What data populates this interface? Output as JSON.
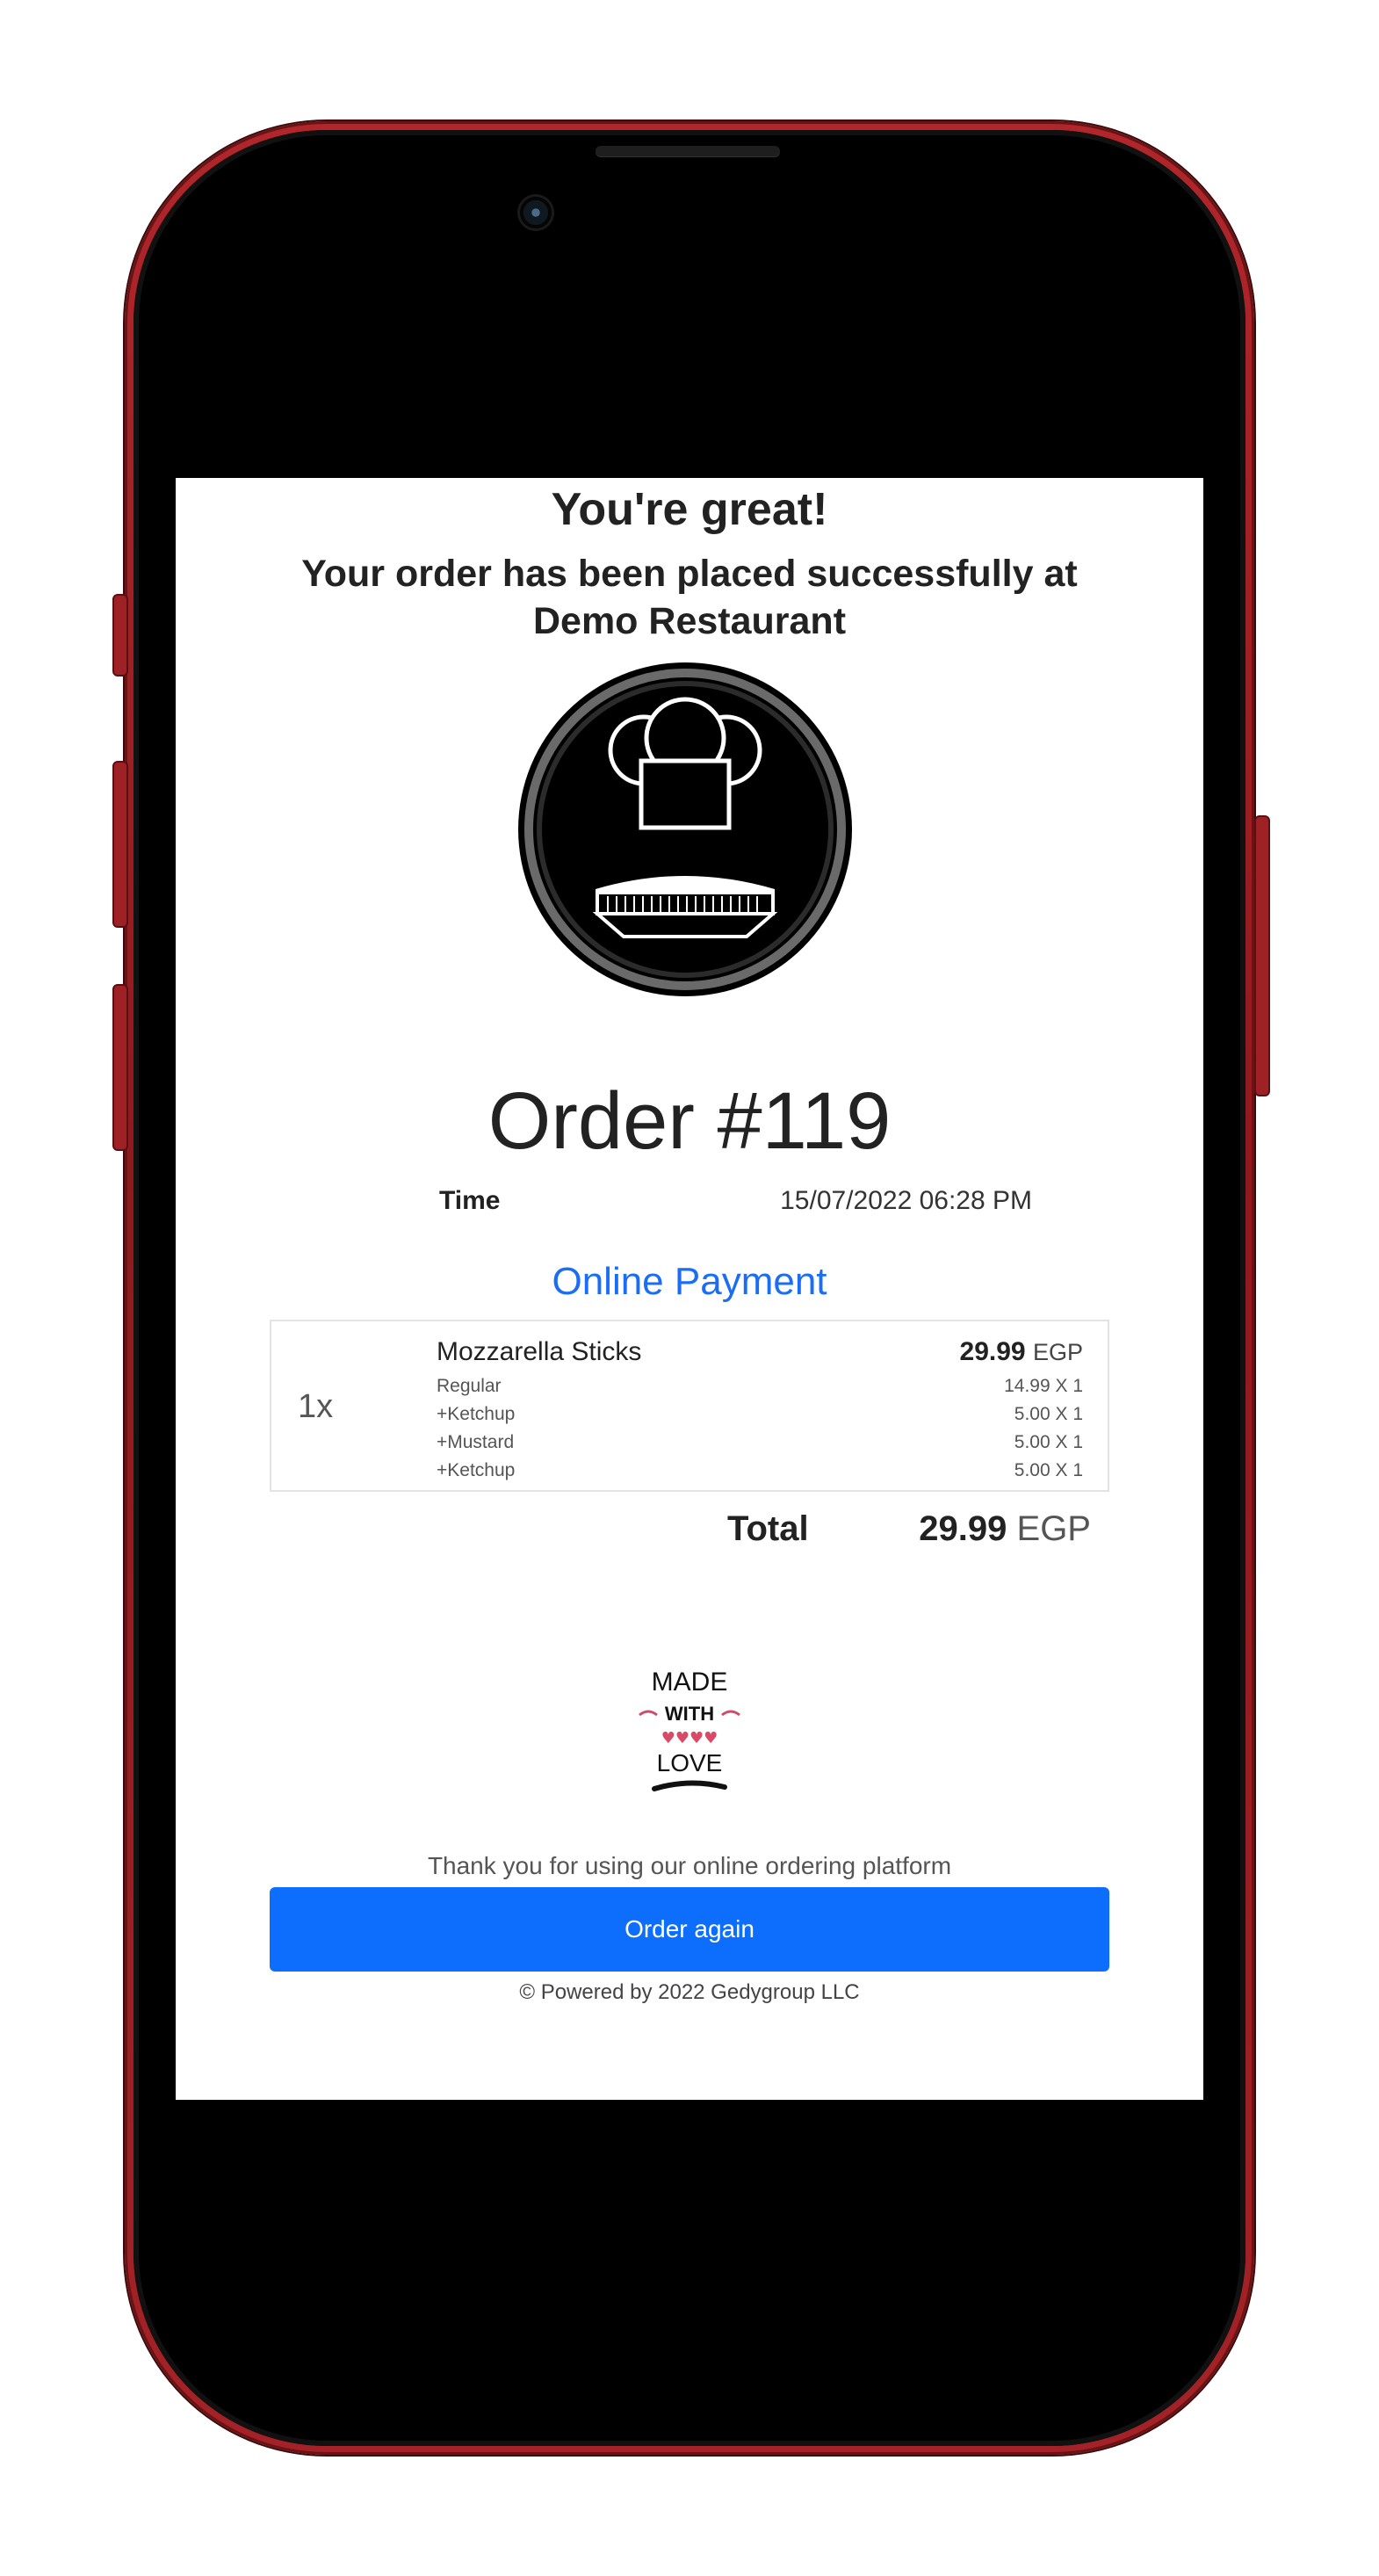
{
  "screen": {
    "title": "You're great!",
    "subtitle": "Your order has been placed successfully at Demo Restaurant",
    "logo_icon": "chef-hat-logo-icon",
    "order_number": "Order #119",
    "time_label": "Time",
    "time_value": "15/07/2022 06:28 PM",
    "payment_method": "Online Payment",
    "payment_color": "#1b6ef3",
    "item": {
      "quantity": "1x",
      "name": "Mozzarella Sticks",
      "price": "29.99",
      "currency": "EGP",
      "options": [
        {
          "name": "Regular",
          "price": "14.99 X 1"
        },
        {
          "name": "+Ketchup",
          "price": "5.00 X 1"
        },
        {
          "name": "+Mustard",
          "price": "5.00 X 1"
        },
        {
          "name": "+Ketchup",
          "price": "5.00 X 1"
        }
      ]
    },
    "total_label": "Total",
    "total_value": "29.99",
    "total_currency": "EGP",
    "made_with_love": {
      "line1": "MADE",
      "line2": "WITH",
      "line3": "LOVE",
      "icon": "made-with-love-badge-icon"
    },
    "thanks_text": "Thank you for using our online ordering platform",
    "order_again_label": "Order again",
    "button_color": "#0d6efd",
    "powered_by": "© Powered by 2022 Gedygroup LLC"
  },
  "device": {
    "frame_color": "#b0262b"
  }
}
